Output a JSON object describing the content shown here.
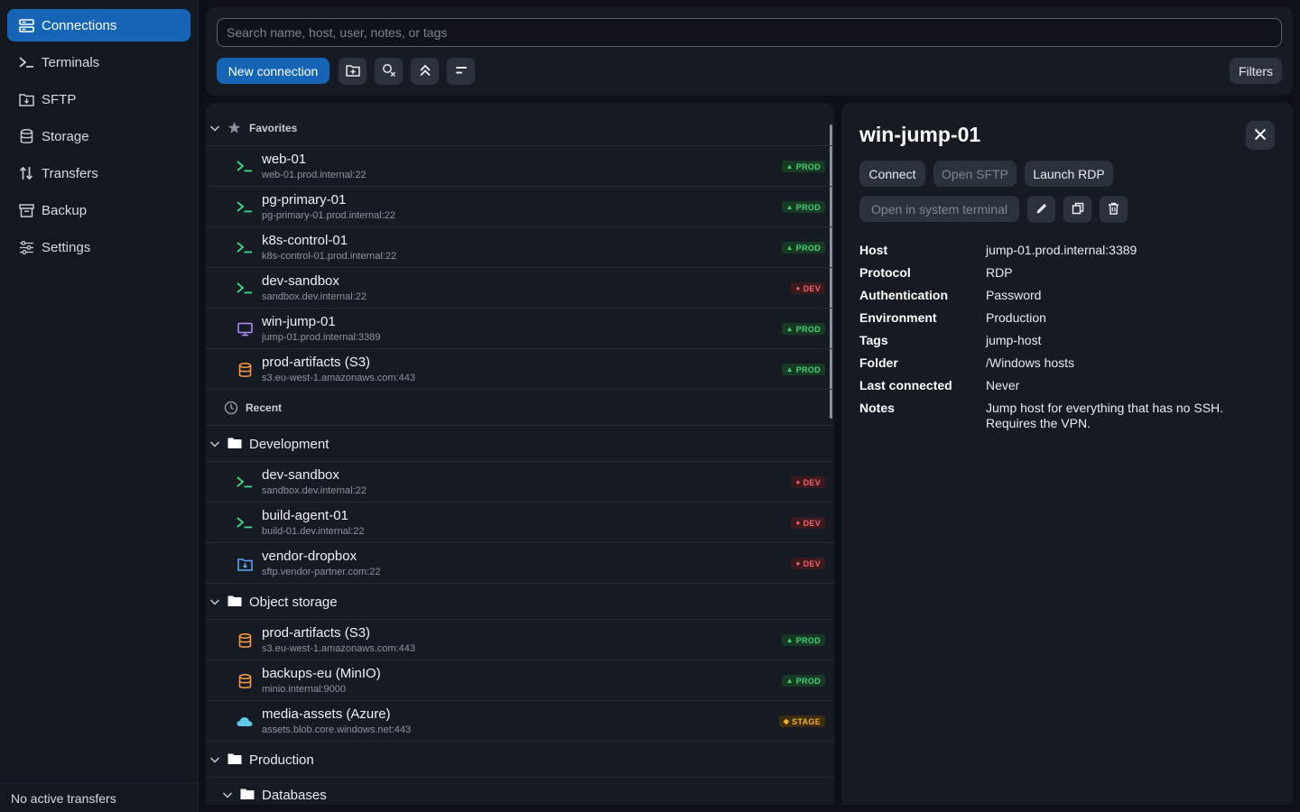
{
  "sidebar": {
    "items": [
      {
        "label": "Connections",
        "icon": "connections-icon",
        "active": true
      },
      {
        "label": "Terminals",
        "icon": "terminal-icon"
      },
      {
        "label": "SFTP",
        "icon": "sftp-folder-icon"
      },
      {
        "label": "Storage",
        "icon": "database-icon"
      },
      {
        "label": "Transfers",
        "icon": "transfer-arrows-icon"
      },
      {
        "label": "Backup",
        "icon": "archive-icon"
      },
      {
        "label": "Settings",
        "icon": "sliders-icon"
      }
    ],
    "footer": "No active transfers"
  },
  "toolbar": {
    "search_placeholder": "Search name, host, user, notes, or tags",
    "new_connection": "New connection",
    "filters": "Filters"
  },
  "list": {
    "favorites_label": "Favorites",
    "recent_label": "Recent",
    "favorites": [
      {
        "name": "web-01",
        "host": "web-01.prod.internal:22",
        "type": "ssh",
        "badge": "PROD"
      },
      {
        "name": "pg-primary-01",
        "host": "pg-primary-01.prod.internal:22",
        "type": "ssh",
        "badge": "PROD"
      },
      {
        "name": "k8s-control-01",
        "host": "k8s-control-01.prod.internal:22",
        "type": "ssh",
        "badge": "PROD"
      },
      {
        "name": "dev-sandbox",
        "host": "sandbox.dev.internal:22",
        "type": "ssh",
        "badge": "DEV"
      },
      {
        "name": "win-jump-01",
        "host": "jump-01.prod.internal:3389",
        "type": "rdp",
        "badge": "PROD"
      },
      {
        "name": "prod-artifacts (S3)",
        "host": "s3.eu-west-1.amazonaws.com:443",
        "type": "s3",
        "badge": "PROD"
      }
    ],
    "development_label": "Development",
    "development": [
      {
        "name": "dev-sandbox",
        "host": "sandbox.dev.internal:22",
        "type": "ssh",
        "badge": "DEV"
      },
      {
        "name": "build-agent-01",
        "host": "build-01.dev.internal:22",
        "type": "ssh",
        "badge": "DEV"
      },
      {
        "name": "vendor-dropbox",
        "host": "sftp.vendor-partner.com:22",
        "type": "sftp",
        "badge": "DEV"
      }
    ],
    "object_storage_label": "Object storage",
    "object_storage": [
      {
        "name": "prod-artifacts (S3)",
        "host": "s3.eu-west-1.amazonaws.com:443",
        "type": "s3",
        "badge": "PROD"
      },
      {
        "name": "backups-eu (MinIO)",
        "host": "minio.internal:9000",
        "type": "s3",
        "badge": "PROD"
      },
      {
        "name": "media-assets (Azure)",
        "host": "assets.blob.core.windows.net:443",
        "type": "azure",
        "badge": "STAGE"
      }
    ],
    "production_label": "Production",
    "databases_label": "Databases"
  },
  "detail": {
    "title": "win-jump-01",
    "connect": "Connect",
    "open_sftp": "Open SFTP",
    "launch_rdp": "Launch RDP",
    "open_terminal": "Open in system terminal",
    "fields": [
      {
        "key": "Host",
        "value": "jump-01.prod.internal:3389"
      },
      {
        "key": "Protocol",
        "value": "RDP"
      },
      {
        "key": "Authentication",
        "value": "Password"
      },
      {
        "key": "Environment",
        "value": "Production"
      },
      {
        "key": "Tags",
        "value": "jump-host"
      },
      {
        "key": "Folder",
        "value": "/Windows hosts"
      },
      {
        "key": "Last connected",
        "value": "Never"
      },
      {
        "key": "Notes",
        "value": "Jump host for everything that has no SSH. Requires the VPN."
      }
    ]
  },
  "colors": {
    "accent": "#1664b5",
    "prod": "#46d073",
    "dev": "#f0616b",
    "stage": "#f0b429",
    "ssh_icon": "#3ddc84",
    "rdp_icon": "#b48cff",
    "s3_icon": "#ff9f43",
    "sftp_icon": "#5aa9ff",
    "azure_icon": "#5ec8e6"
  }
}
